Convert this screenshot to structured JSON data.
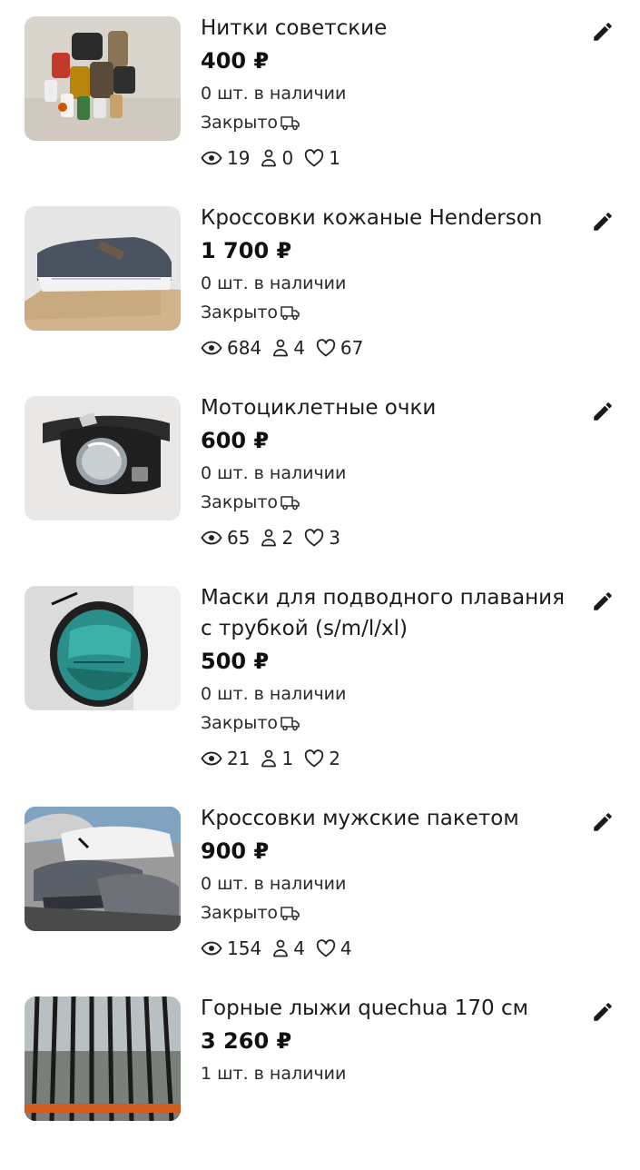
{
  "currency": "₽",
  "items": [
    {
      "title": "Нитки советские",
      "price": "400 ₽",
      "stock": "0 шт. в наличии",
      "status": "Закрыто",
      "views": "19",
      "contacts": "0",
      "likes": "1"
    },
    {
      "title": "Кроссовки кожаные Henderson",
      "price": "1 700 ₽",
      "stock": "0 шт. в наличии",
      "status": "Закрыто",
      "views": "684",
      "contacts": "4",
      "likes": "67"
    },
    {
      "title": "Мотоциклетные очки",
      "price": "600 ₽",
      "stock": "0 шт. в наличии",
      "status": "Закрыто",
      "views": "65",
      "contacts": "2",
      "likes": "3"
    },
    {
      "title": "Маски для подводного плавания с трубкой (s/m/l/xl)",
      "price": "500 ₽",
      "stock": "0 шт. в наличии",
      "status": "Закрыто",
      "views": "21",
      "contacts": "1",
      "likes": "2"
    },
    {
      "title": "Кроссовки мужские пакетом",
      "price": "900 ₽",
      "stock": "0 шт. в наличии",
      "status": "Закрыто",
      "views": "154",
      "contacts": "4",
      "likes": "4"
    },
    {
      "title": "Горные лыжи quechua 170 см",
      "price": "3 260 ₽",
      "stock": "1 шт. в наличии",
      "status": "",
      "views": "",
      "contacts": "",
      "likes": ""
    }
  ],
  "icons": {
    "edit": "pencil-icon",
    "delivery": "truck-icon",
    "views": "eye-icon",
    "contacts": "person-icon",
    "likes": "heart-icon"
  }
}
